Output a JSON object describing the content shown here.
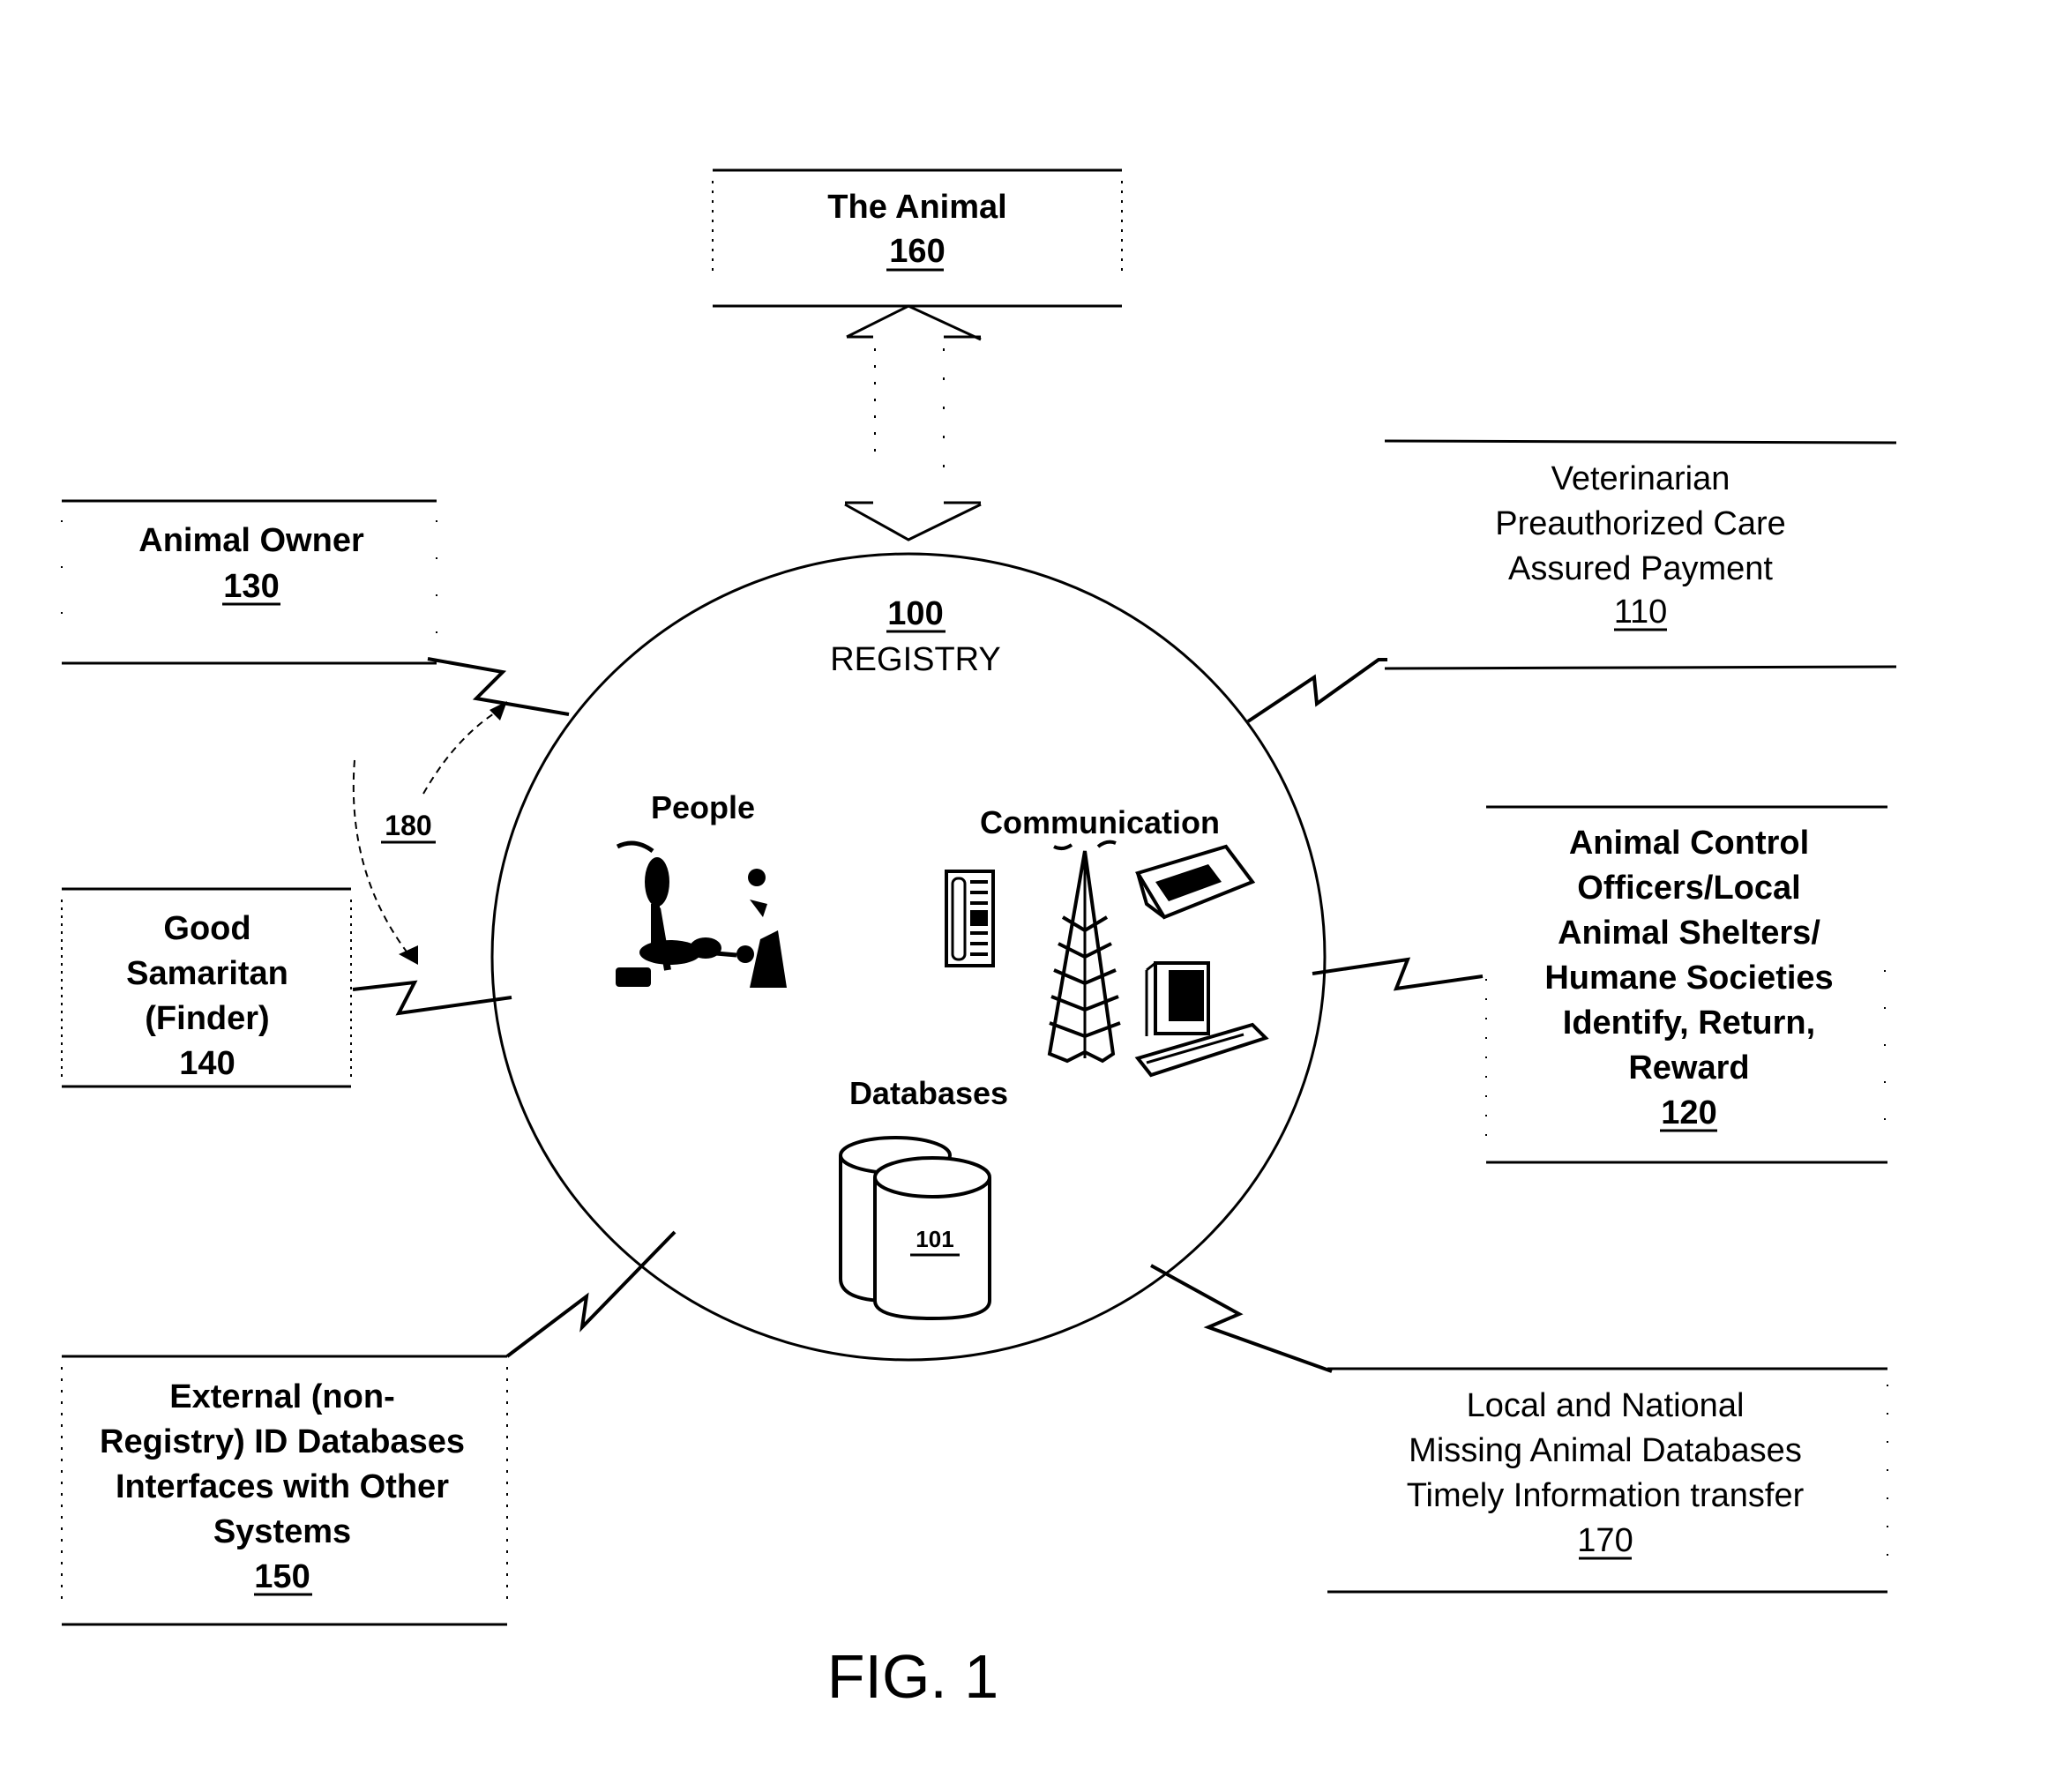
{
  "figure_label": "FIG. 1",
  "registry": {
    "ref": "100",
    "title": "REGISTRY",
    "sections": {
      "people": "People",
      "communication": "Communication",
      "databases": "Databases"
    },
    "database_ref": "101"
  },
  "boxes": {
    "animal": {
      "lines": [
        "The Animal"
      ],
      "ref": "160"
    },
    "owner": {
      "lines": [
        "Animal Owner"
      ],
      "ref": "130"
    },
    "samaritan": {
      "lines": [
        "Good",
        "Samaritan",
        "(Finder)"
      ],
      "ref": "140"
    },
    "veterinarian": {
      "lines": [
        "Veterinarian",
        "Preauthorized Care",
        "Assured Payment"
      ],
      "ref": "110"
    },
    "animal_control": {
      "lines": [
        "Animal Control",
        "Officers/Local",
        "Animal Shelters/",
        "Humane Societies",
        "Identify, Return,",
        "Reward"
      ],
      "ref": "120"
    },
    "external": {
      "lines": [
        "External (non-",
        "Registry) ID Databases",
        "Interfaces with Other",
        "Systems"
      ],
      "ref": "150"
    },
    "missing": {
      "lines": [
        "Local and National",
        "Missing Animal Databases",
        "Timely Information transfer"
      ],
      "ref": "170"
    }
  },
  "connector_180_ref": "180"
}
